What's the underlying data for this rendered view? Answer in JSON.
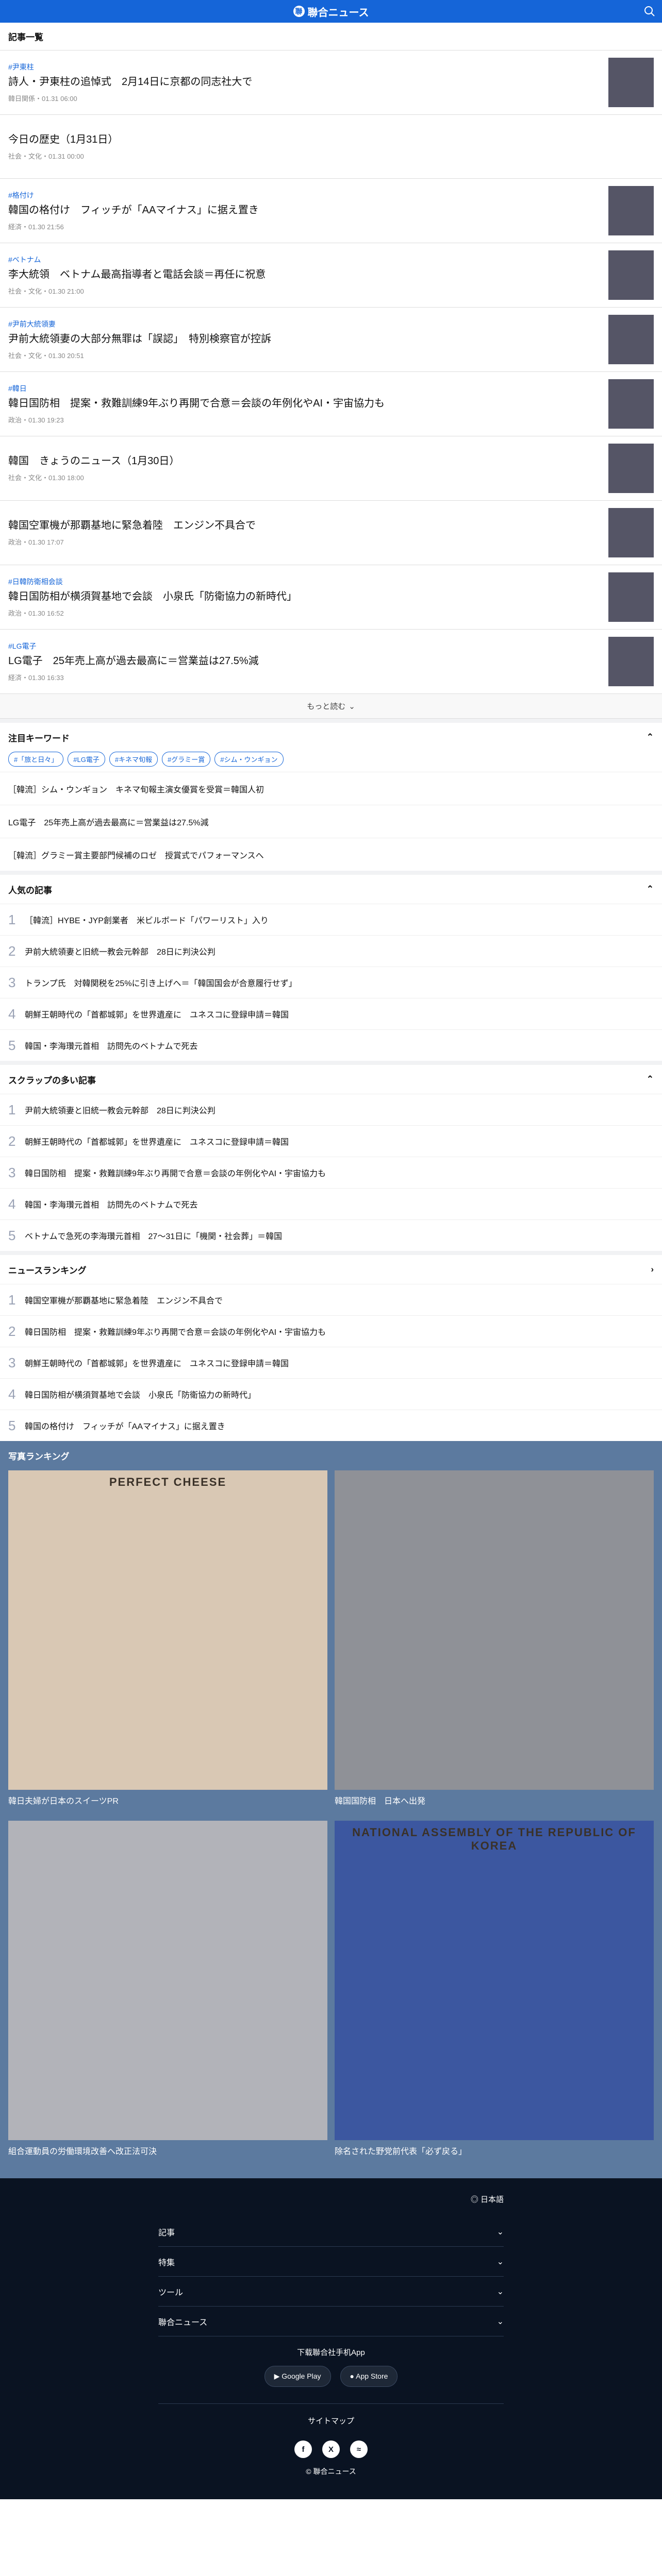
{
  "brand": "聯合ニュース",
  "section_title": "記事一覧",
  "articles": [
    {
      "tag": "#尹東柱",
      "title": "詩人・尹東柱の追悼式　2月14日に京都の同志社大で",
      "meta": "韓日関係・01.31 06:00",
      "thumb": true
    },
    {
      "tag": "",
      "title": "今日の歴史（1月31日）",
      "meta": "社会・文化・01.31 00:00",
      "thumb": false
    },
    {
      "tag": "#格付け",
      "title": "韓国の格付け　フィッチが「AAマイナス」に据え置き",
      "meta": "経済・01.30 21:56",
      "thumb": true
    },
    {
      "tag": "#ベトナム",
      "title": "李大統領　ベトナム最高指導者と電話会談＝再任に祝意",
      "meta": "社会・文化・01.30 21:00",
      "thumb": true
    },
    {
      "tag": "#尹前大統領妻",
      "title": "尹前大統領妻の大部分無罪は「誤認」　特別検察官が控訴",
      "meta": "社会・文化・01.30 20:51",
      "thumb": true
    },
    {
      "tag": "#韓日",
      "title": "韓日国防相　提案・救難訓練9年ぶり再開で合意＝会談の年例化やAI・宇宙協力も",
      "meta": "政治・01.30 19:23",
      "thumb": true
    },
    {
      "tag": "",
      "title": "韓国　きょうのニュース（1月30日）",
      "meta": "社会・文化・01.30 18:00",
      "thumb": true
    },
    {
      "tag": "",
      "title": "韓国空軍機が那覇基地に緊急着陸　エンジン不具合で",
      "meta": "政治・01.30 17:07",
      "thumb": true
    },
    {
      "tag": "#日韓防衛相会談",
      "title": "韓日国防相が横須賀基地で会談　小泉氏「防衛協力の新時代」",
      "meta": "政治・01.30 16:52",
      "thumb": true
    },
    {
      "tag": "#LG電子",
      "title": "LG電子　25年売上高が過去最高に＝営業益は27.5%減",
      "meta": "経済・01.30 16:33",
      "thumb": true
    }
  ],
  "more_label": "もっと読む",
  "keywords": {
    "title": "注目キーワード",
    "chips": [
      "#「旅と日々」",
      "#LG電子",
      "#キネマ旬報",
      "#グラミー賞",
      "#シム・ウンギョン"
    ],
    "items": [
      "［韓流］シム・ウンギョン　キネマ旬報主演女優賞を受賞＝韓国人初",
      "LG電子　25年売上高が過去最高に＝営業益は27.5%減",
      "［韓流］グラミー賞主要部門候補のロゼ　授賞式でパフォーマンスへ"
    ]
  },
  "popular": {
    "title": "人気の記事",
    "items": [
      "［韓流］HYBE・JYP創業者　米ビルボード「パワーリスト」入り",
      "尹前大統領妻と旧統一教会元幹部　28日に判決公判",
      "トランプ氏　対韓関税を25%に引き上げへ＝「韓国国会が合意履行せず」",
      "朝鮮王朝時代の「首都城郭」を世界遺産に　ユネスコに登録申請＝韓国",
      "韓国・李海瓚元首相　訪問先のベトナムで死去"
    ]
  },
  "scrap": {
    "title": "スクラップの多い記事",
    "items": [
      "尹前大統領妻と旧統一教会元幹部　28日に判決公判",
      "朝鮮王朝時代の「首都城郭」を世界遺産に　ユネスコに登録申請＝韓国",
      "韓日国防相　提案・救難訓練9年ぶり再開で合意＝会談の年例化やAI・宇宙協力も",
      "韓国・李海瓚元首相　訪問先のベトナムで死去",
      "ベトナムで急死の李海瓚元首相　27～31日に「機関・社会葬」＝韓国"
    ]
  },
  "ranking": {
    "title": "ニュースランキング",
    "items": [
      "韓国空軍機が那覇基地に緊急着陸　エンジン不具合で",
      "韓日国防相　提案・救難訓練9年ぶり再開で合意＝会談の年例化やAI・宇宙協力も",
      "朝鮮王朝時代の「首都城郭」を世界遺産に　ユネスコに登録申請＝韓国",
      "韓日国防相が横須賀基地で会談　小泉氏「防衛協力の新時代」",
      "韓国の格付け　フィッチが「AAマイナス」に据え置き"
    ]
  },
  "photos": {
    "title": "写真ランキング",
    "items": [
      {
        "caption": "韓日夫婦が日本のスイーツPR",
        "bg": "#d9c8b4",
        "text": "PERFECT CHEESE"
      },
      {
        "caption": "韓国国防相　日本へ出発",
        "bg": "#8f9197",
        "text": ""
      },
      {
        "caption": "組合運動員の労働環境改善へ改正法可決",
        "bg": "#b2b3b9",
        "text": ""
      },
      {
        "caption": "除名された野党前代表「必ず戻る」",
        "bg": "#3c57a0",
        "text": "NATIONAL ASSEMBLY OF THE REPUBLIC OF KOREA"
      }
    ]
  },
  "footer": {
    "lang": "日本語",
    "rows": [
      "記事",
      "特集",
      "ツール",
      "聯合ニュース"
    ],
    "app_title": "下载聯合社手机App",
    "apps": [
      "Google Play",
      "App Store"
    ],
    "sitemap": "サイトマップ",
    "copyright": "© 聯合ニュース"
  }
}
